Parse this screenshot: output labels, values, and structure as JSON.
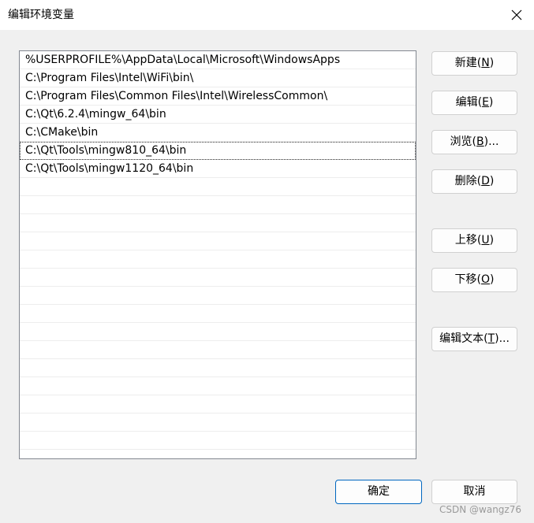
{
  "window": {
    "title": "编辑环境变量",
    "close_icon": "close-icon"
  },
  "path_list": {
    "items": [
      "%USERPROFILE%\\AppData\\Local\\Microsoft\\WindowsApps",
      "C:\\Program Files\\Intel\\WiFi\\bin\\",
      "C:\\Program Files\\Common Files\\Intel\\WirelessCommon\\",
      "C:\\Qt\\6.2.4\\mingw_64\\bin",
      "C:\\CMake\\bin",
      "C:\\Qt\\Tools\\mingw810_64\\bin",
      "C:\\Qt\\Tools\\mingw1120_64\\bin",
      "",
      "",
      "",
      "",
      "",
      "",
      "",
      "",
      "",
      "",
      "",
      "",
      "",
      "",
      ""
    ],
    "selected_index": 5
  },
  "buttons": {
    "new": {
      "label": "新建(",
      "key": "N",
      "suffix": ")"
    },
    "edit": {
      "label": "编辑(",
      "key": "E",
      "suffix": ")"
    },
    "browse": {
      "label": "浏览(",
      "key": "B",
      "suffix": ")..."
    },
    "delete": {
      "label": "删除(",
      "key": "D",
      "suffix": ")"
    },
    "move_up": {
      "label": "上移(",
      "key": "U",
      "suffix": ")"
    },
    "move_down": {
      "label": "下移(",
      "key": "O",
      "suffix": ")"
    },
    "edit_text": {
      "label": "编辑文本(",
      "key": "T",
      "suffix": ")..."
    },
    "ok": "确定",
    "cancel": "取消"
  },
  "colors": {
    "default_button_border": "#0067c0",
    "list_border": "#828790"
  },
  "watermark": "CSDN @wangz76"
}
